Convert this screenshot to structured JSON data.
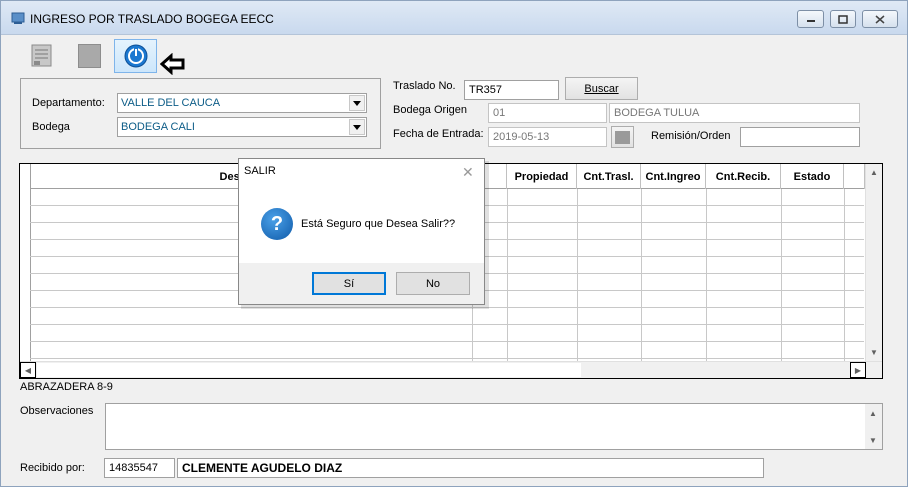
{
  "window": {
    "title": "INGRESO POR TRASLADO BOGEGA EECC",
    "min_glyph": "▭",
    "max_glyph": "□",
    "close_glyph": "✕"
  },
  "toolbar": {
    "icons": [
      "document-icon",
      "stop-icon",
      "power-icon",
      "left-arrow-icon"
    ]
  },
  "filters": {
    "department_label": "Departamento:",
    "department_value": "VALLE DEL CAUCA",
    "warehouse_label": "Bodega",
    "warehouse_value": "BODEGA CALI"
  },
  "transfer": {
    "transfer_no_label": "Traslado No.",
    "transfer_no_value": "TR357",
    "search_label": "Buscar",
    "origin_label": "Bodega Origen",
    "origin_code": "01",
    "origin_name": "BODEGA TULUA",
    "entry_date_label": "Fecha de Entrada:",
    "entry_date_value": "2019-05-13",
    "remission_label": "Remisión/Orden",
    "remission_value": ""
  },
  "grid": {
    "columns": [
      "Descripción",
      "",
      "Propiedad",
      "Cnt.Trasl.",
      "Cnt.Ingreo",
      "Cnt.Recib.",
      "Estado",
      ""
    ]
  },
  "dialog": {
    "title": "SALIR",
    "close_glyph": "✕",
    "question_glyph": "?",
    "message": "Está Seguro que Desea Salir??",
    "yes_label": "Sí",
    "no_label": "No"
  },
  "footer": {
    "item_caption": "ABRAZADERA 8-9",
    "observations_label": "Observaciones",
    "observations_value": "",
    "received_label": "Recibido por:",
    "received_id": "14835547",
    "received_name": "CLEMENTE AGUDELO DIAZ"
  },
  "colors": {
    "value_text": "#0c5c87",
    "accent": "#0078d7",
    "dialog_icon": "#1565c0"
  }
}
